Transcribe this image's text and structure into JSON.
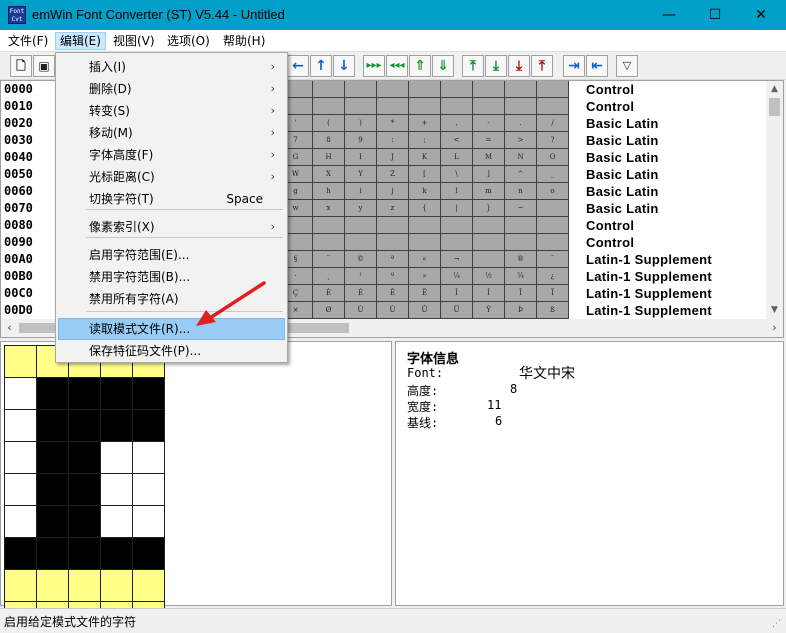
{
  "window": {
    "title": "emWin Font Converter (ST) V5.44 - Untitled",
    "icon_text": "Font Cvt",
    "minimize": "—",
    "maximize": "☐",
    "close": "✕"
  },
  "menubar": [
    {
      "label": "文件(F)"
    },
    {
      "label": "编辑(E)"
    },
    {
      "label": "视图(V)"
    },
    {
      "label": "选项(O)"
    },
    {
      "label": "帮助(H)"
    }
  ],
  "toolbar": {
    "icons": [
      "new-file-icon",
      "save-icon",
      "arrow-left-icon",
      "arrow-up-icon",
      "arrow-down-icon",
      "fast-forward-icon",
      "fast-rewind-icon",
      "double-up-icon",
      "double-down-icon",
      "align-top-icon",
      "move-down-icon",
      "move-down-red-icon",
      "move-up-red-icon",
      "arrow-right-bar-icon",
      "arrow-left-bar-icon",
      "filter-icon"
    ]
  },
  "char_list": {
    "codes": [
      "0000",
      "0010",
      "0020",
      "0030",
      "0040",
      "0050",
      "0060",
      "0070",
      "0080",
      "0090",
      "00A0",
      "00B0",
      "00C0",
      "00D0"
    ],
    "blocks": [
      "Control",
      "Control",
      "Basic Latin",
      "Basic Latin",
      "Basic Latin",
      "Basic Latin",
      "Basic Latin",
      "Basic Latin",
      "Control",
      "Control",
      "Latin-1 Supplement",
      "Latin-1 Supplement",
      "Latin-1 Supplement",
      "Latin-1 Supplement"
    ],
    "grid_rows": [
      [
        "",
        "",
        "",
        "",
        "",
        "",
        "",
        "",
        ""
      ],
      [
        "",
        "",
        "",
        "",
        "",
        "",
        "",
        "",
        ""
      ],
      [
        "'",
        "(",
        ")",
        "*",
        "+",
        ",",
        "-",
        ".",
        "/"
      ],
      [
        "7",
        "8",
        "9",
        ":",
        ";",
        "<",
        "=",
        ">",
        "?"
      ],
      [
        "G",
        "H",
        "I",
        "J",
        "K",
        "L",
        "M",
        "N",
        "O"
      ],
      [
        "W",
        "X",
        "Y",
        "Z",
        "[",
        "\\",
        "]",
        "^",
        "_"
      ],
      [
        "g",
        "h",
        "i",
        "j",
        "k",
        "l",
        "m",
        "n",
        "o"
      ],
      [
        "w",
        "x",
        "y",
        "z",
        "{",
        "|",
        "}",
        "~",
        ""
      ],
      [
        "",
        "",
        "",
        "",
        "",
        "",
        "",
        "",
        ""
      ],
      [
        "",
        "",
        "",
        "",
        "",
        "",
        "",
        "",
        ""
      ],
      [
        "§",
        "¨",
        "©",
        "ª",
        "«",
        "¬",
        "",
        "®",
        "¯"
      ],
      [
        "·",
        "¸",
        "¹",
        "º",
        "»",
        "¼",
        "½",
        "¾",
        "¿"
      ],
      [
        "Ç",
        "È",
        "É",
        "Ê",
        "Ë",
        "Ì",
        "Í",
        "Î",
        "Ï"
      ],
      [
        "×",
        "Ø",
        "Ù",
        "Ú",
        "Û",
        "Ü",
        "Ý",
        "Þ",
        "ß"
      ]
    ]
  },
  "glyph_editor": {
    "pixels": [
      "yyyyy",
      "wbbbb",
      "wbbbb",
      "wbbww",
      "wbbww",
      "wbbww",
      "bbbbb",
      "yyyyy",
      "yyyyy"
    ]
  },
  "font_info": {
    "title": "字体信息",
    "font_label": "Font:",
    "font_value": "华文中宋",
    "height_label": "高度:",
    "height_value": "8",
    "width_label": "宽度:",
    "width_value": "11",
    "baseline_label": "基线:",
    "baseline_value": "6"
  },
  "edit_menu": {
    "items": [
      {
        "label": "插入(I)",
        "submenu": true
      },
      {
        "label": "删除(D)",
        "submenu": true
      },
      {
        "label": "转变(S)",
        "submenu": true
      },
      {
        "label": "移动(M)",
        "submenu": true
      },
      {
        "label": "字体高度(F)",
        "submenu": true
      },
      {
        "label": "光标距离(C)",
        "submenu": true
      },
      {
        "label": "切换字符(T)",
        "shortcut": "Space"
      },
      {
        "label": "像素索引(X)",
        "submenu": true
      },
      {
        "label": "启用字符范围(E)..."
      },
      {
        "label": "禁用字符范围(B)..."
      },
      {
        "label": "禁用所有字符(A)"
      },
      {
        "label": "读取模式文件(R)...",
        "highlighted": true
      },
      {
        "label": "保存特征码文件(P)..."
      }
    ],
    "submenu_glyph": "›"
  },
  "status": {
    "text": "启用给定模式文件的字符"
  },
  "colors": {
    "title_bar": "#00a0c8",
    "highlight": "#99ccf5",
    "pixel_yellow": "#ffff88",
    "arrow_red": "#e02020"
  }
}
